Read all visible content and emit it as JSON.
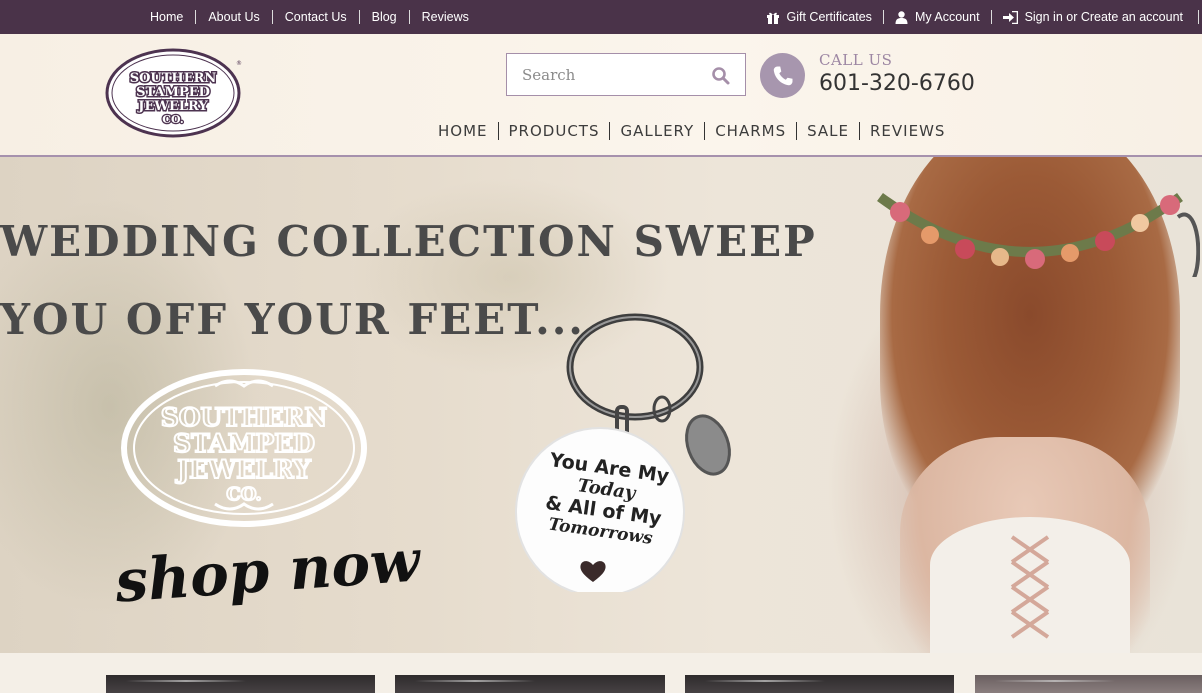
{
  "topbar": {
    "left_links": [
      "Home",
      "About Us",
      "Contact Us",
      "Blog",
      "Reviews"
    ],
    "gift_certificates": "Gift Certificates",
    "my_account": "My Account",
    "sign_in": "Sign in or Create an account"
  },
  "header": {
    "logo_text": [
      "SOUTHERN",
      "STAMPED",
      "JEWELRY",
      "CO."
    ],
    "search_placeholder": "Search",
    "call_label": "CALL US",
    "call_number": "601-320-6760",
    "nav": [
      "HOME",
      "PRODUCTS",
      "GALLERY",
      "CHARMS",
      "SALE",
      "REVIEWS"
    ]
  },
  "hero": {
    "line1": "WEDDING COLLECTION SWEEP",
    "line2": "YOU OFF YOUR FEET...",
    "logo_text": [
      "SOUTHERN",
      "STAMPED",
      "JEWELRY",
      "CO."
    ],
    "shop_now": "shop now",
    "tag_lines": [
      "You Are My",
      "Today",
      "& All of My",
      "Tomorrows"
    ]
  },
  "colors": {
    "topbar_bg": "#4a3349",
    "accent": "#a796ae",
    "logo_purple": "#4d3350"
  }
}
